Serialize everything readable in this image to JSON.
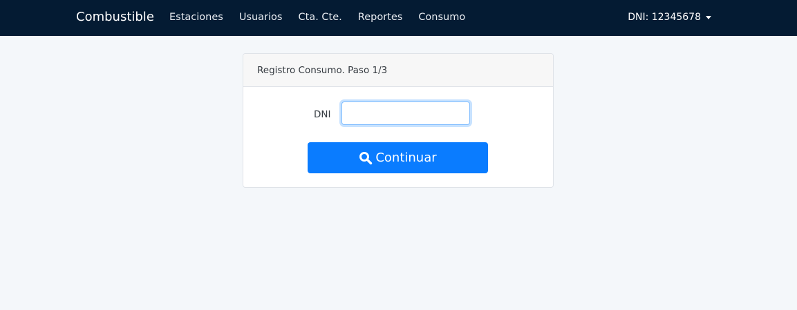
{
  "navbar": {
    "brand": "Combustible",
    "links": [
      "Estaciones",
      "Usuarios",
      "Cta. Cte.",
      "Reportes",
      "Consumo"
    ],
    "user_menu": "DNI: 12345678"
  },
  "card": {
    "title": "Registro Consumo. Paso 1/3",
    "dni_label": "DNI",
    "dni_value": "",
    "continue_label": "Continuar"
  },
  "colors": {
    "navbar_bg": "#041b33",
    "page_bg": "#f4f7fa",
    "primary": "#0a7cff"
  },
  "icons": {
    "continue_icon": "search-icon",
    "user_caret": "caret-down-icon"
  }
}
